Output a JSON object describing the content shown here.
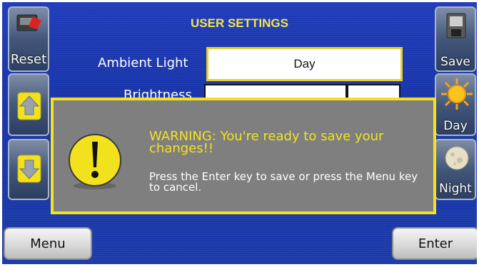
{
  "screen": {
    "title": "USER SETTINGS"
  },
  "left_buttons": {
    "reset_label": "Reset"
  },
  "right_buttons": {
    "save_label": "Save",
    "day_label": "Day",
    "night_label": "Night"
  },
  "fields": {
    "ambient_light": {
      "label": "Ambient Light",
      "value": "Day"
    },
    "brightness": {
      "label": "Brightness"
    }
  },
  "dialog": {
    "warning_title": "WARNING: You're ready to save your changes!!",
    "warning_body": "Press the Enter key to save or press the Menu key to cancel."
  },
  "bottom_buttons": {
    "menu_label": "Menu",
    "enter_label": "Enter"
  },
  "colors": {
    "background": "#1f3bb8",
    "accent_yellow": "#f3e31e",
    "dialog_gray": "#7f7f7f"
  }
}
